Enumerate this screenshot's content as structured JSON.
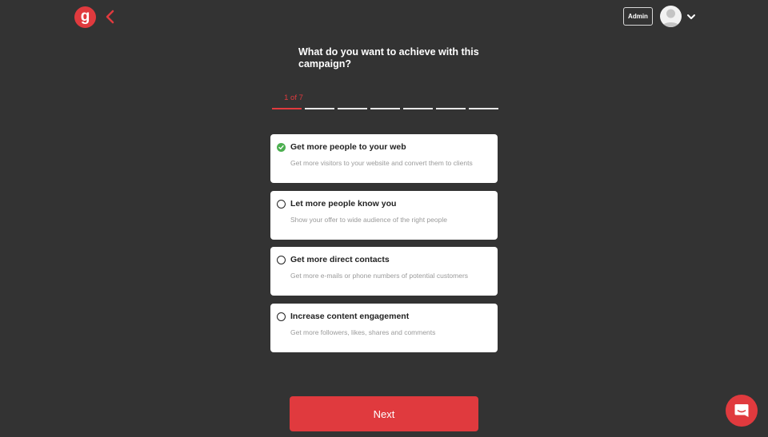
{
  "header": {
    "logo_text": "g",
    "admin_label": "Admin"
  },
  "wizard": {
    "question": "What do you want to achieve with this campaign?",
    "step_label": "1 of 7",
    "progress": {
      "current_step": 1,
      "total_steps": 7
    }
  },
  "options": [
    {
      "title": "Get more people to your web",
      "description": "Get more visitors to your website and convert them to clients",
      "selected": true
    },
    {
      "title": "Let more people know you",
      "description": "Show your offer to wide audience of the right people",
      "selected": false
    },
    {
      "title": "Get more direct contacts",
      "description": "Get more e-mails or phone numbers of potential customers",
      "selected": false
    },
    {
      "title": "Increase content engagement",
      "description": "Get more followers, likes, shares and comments",
      "selected": false
    }
  ],
  "footer": {
    "next_label": "Next"
  },
  "colors": {
    "background": "#333333",
    "accent": "#e03a3e",
    "selected": "#4caf50"
  },
  "icons": {
    "back": "chevron-left-icon",
    "menu": "chevron-down-icon",
    "chat": "chat-icon",
    "check": "check-icon"
  }
}
